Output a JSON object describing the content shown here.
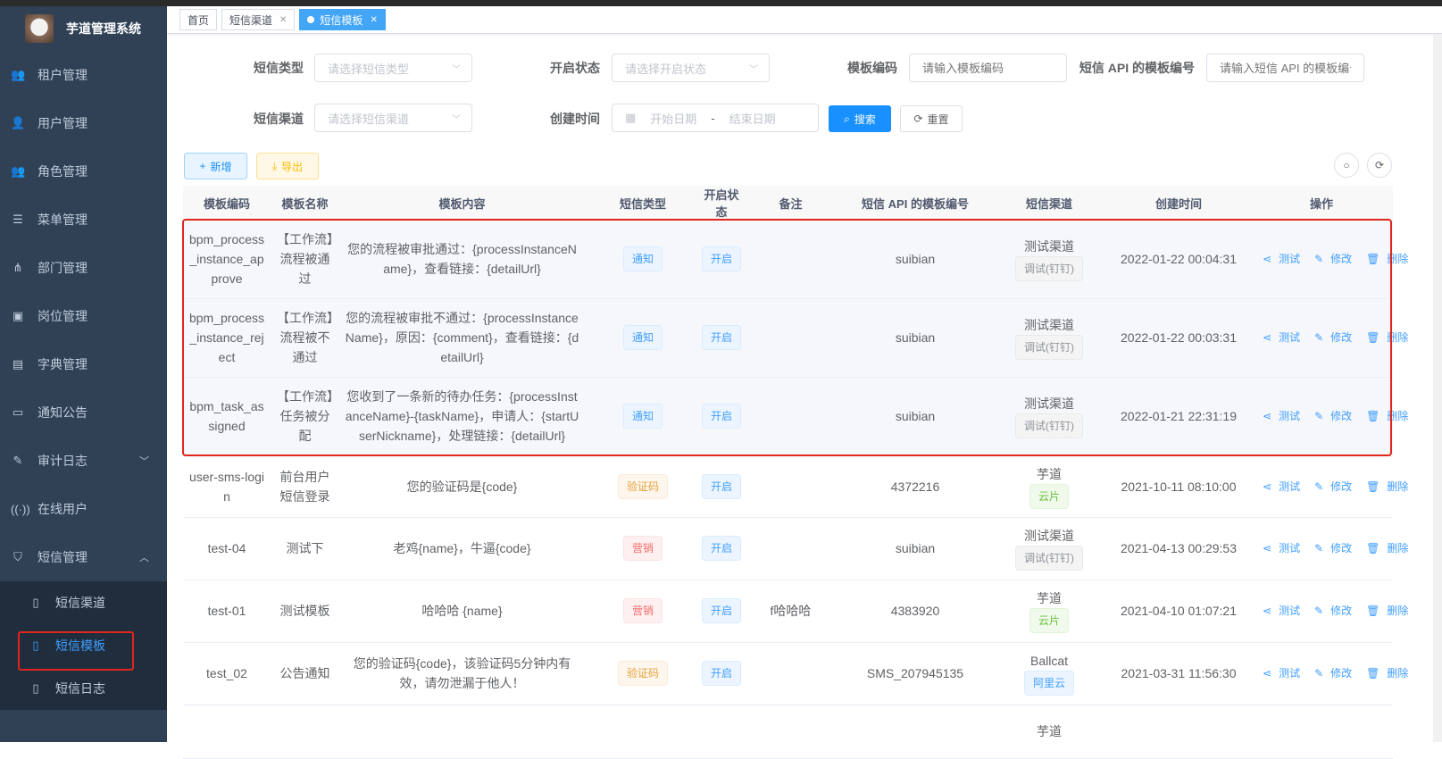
{
  "app": {
    "title": "芋道管理系统"
  },
  "sidebar": {
    "items": [
      {
        "label": "租户管理",
        "icon": "users-icon"
      },
      {
        "label": "用户管理",
        "icon": "user-icon"
      },
      {
        "label": "角色管理",
        "icon": "peoples-icon"
      },
      {
        "label": "菜单管理",
        "icon": "tree-table-icon"
      },
      {
        "label": "部门管理",
        "icon": "tree-icon"
      },
      {
        "label": "岗位管理",
        "icon": "post-icon"
      },
      {
        "label": "字典管理",
        "icon": "dict-icon"
      },
      {
        "label": "通知公告",
        "icon": "message-icon"
      },
      {
        "label": "审计日志",
        "icon": "log-icon",
        "expandable": true
      },
      {
        "label": "在线用户",
        "icon": "online-icon"
      },
      {
        "label": "短信管理",
        "icon": "shield-icon",
        "expanded": true
      }
    ],
    "submenu": [
      {
        "label": "短信渠道",
        "icon": "phone-icon"
      },
      {
        "label": "短信模板",
        "icon": "phone-icon",
        "active": true
      },
      {
        "label": "短信日志",
        "icon": "phone-icon"
      }
    ]
  },
  "tabs": [
    {
      "label": "首页"
    },
    {
      "label": "短信渠道",
      "closable": true
    },
    {
      "label": "短信模板",
      "closable": true,
      "active": true
    }
  ],
  "search": {
    "sms_type": {
      "label": "短信类型",
      "placeholder": "请选择短信类型"
    },
    "status": {
      "label": "开启状态",
      "placeholder": "请选择开启状态"
    },
    "code": {
      "label": "模板编码",
      "placeholder": "请输入模板编码"
    },
    "api_code": {
      "label": "短信 API 的模板编号",
      "placeholder": "请输入短信 API 的模板编号"
    },
    "channel": {
      "label": "短信渠道",
      "placeholder": "请选择短信渠道"
    },
    "create_time": {
      "label": "创建时间",
      "start": "开始日期",
      "sep": "-",
      "end": "结束日期"
    },
    "search_btn": "搜索",
    "reset_btn": "重置"
  },
  "toolbar": {
    "add": "新增",
    "export": "导出"
  },
  "table": {
    "headers": [
      "模板编码",
      "模板名称",
      "模板内容",
      "短信类型",
      "开启状态",
      "备注",
      "短信 API 的模板编号",
      "短信渠道",
      "创建时间",
      "操作"
    ],
    "actions": {
      "test": "测试",
      "edit": "修改",
      "delete": "删除"
    },
    "rows": [
      {
        "code": "bpm_process_instance_approve",
        "name": "【工作流】流程被通过",
        "content": "您的流程被审批通过：{processInstanceName}，查看链接：{detailUrl}",
        "type": "通知",
        "type_color": "blue",
        "status": "开启",
        "remark": "",
        "api_code": "suibian",
        "channel": "测试渠道",
        "channel_tag": "调试(钉钉)",
        "channel_color": "info",
        "time": "2022-01-22 00:04:31"
      },
      {
        "code": "bpm_process_instance_reject",
        "name": "【工作流】流程被不通过",
        "content": "您的流程被审批不通过：{processInstanceName}，原因：{comment}，查看链接：{detailUrl}",
        "type": "通知",
        "type_color": "blue",
        "status": "开启",
        "remark": "",
        "api_code": "suibian",
        "channel": "测试渠道",
        "channel_tag": "调试(钉钉)",
        "channel_color": "info",
        "time": "2022-01-22 00:03:31"
      },
      {
        "code": "bpm_task_assigned",
        "name": "【工作流】任务被分配",
        "content": "您收到了一条新的待办任务：{processInstanceName}-{taskName}，申请人：{startUserNickname}，处理链接：{detailUrl}",
        "type": "通知",
        "type_color": "blue",
        "status": "开启",
        "remark": "",
        "api_code": "suibian",
        "channel": "测试渠道",
        "channel_tag": "调试(钉钉)",
        "channel_color": "info",
        "time": "2022-01-21 22:31:19"
      },
      {
        "code": "user-sms-login",
        "name": "前台用户短信登录",
        "content": "您的验证码是{code}",
        "type": "验证码",
        "type_color": "warn",
        "status": "开启",
        "remark": "",
        "api_code": "4372216",
        "channel": "芋道",
        "channel_tag": "云片",
        "channel_color": "green",
        "time": "2021-10-11 08:10:00"
      },
      {
        "code": "test-04",
        "name": "测试下",
        "content": "老鸡{name}，牛逼{code}",
        "type": "营销",
        "type_color": "red",
        "status": "开启",
        "remark": "",
        "api_code": "suibian",
        "channel": "测试渠道",
        "channel_tag": "调试(钉钉)",
        "channel_color": "info",
        "time": "2021-04-13 00:29:53"
      },
      {
        "code": "test-01",
        "name": "测试模板",
        "content": "哈哈哈 {name}",
        "type": "营销",
        "type_color": "red",
        "status": "开启",
        "remark": "f哈哈哈",
        "api_code": "4383920",
        "channel": "芋道",
        "channel_tag": "云片",
        "channel_color": "green",
        "time": "2021-04-10 01:07:21"
      },
      {
        "code": "test_02",
        "name": "公告通知",
        "content": "您的验证码{code}，该验证码5分钟内有效，请勿泄漏于他人！",
        "type": "验证码",
        "type_color": "warn",
        "status": "开启",
        "remark": "",
        "api_code": "SMS_207945135",
        "channel": "Ballcat",
        "channel_tag": "阿里云",
        "channel_color": "blue",
        "time": "2021-03-31 11:56:30"
      },
      {
        "code": "",
        "name": "",
        "content": "",
        "type": "",
        "type_color": "",
        "status": "",
        "remark": "",
        "api_code": "",
        "channel": "芋道",
        "channel_tag": "",
        "channel_color": "",
        "time": ""
      }
    ]
  }
}
